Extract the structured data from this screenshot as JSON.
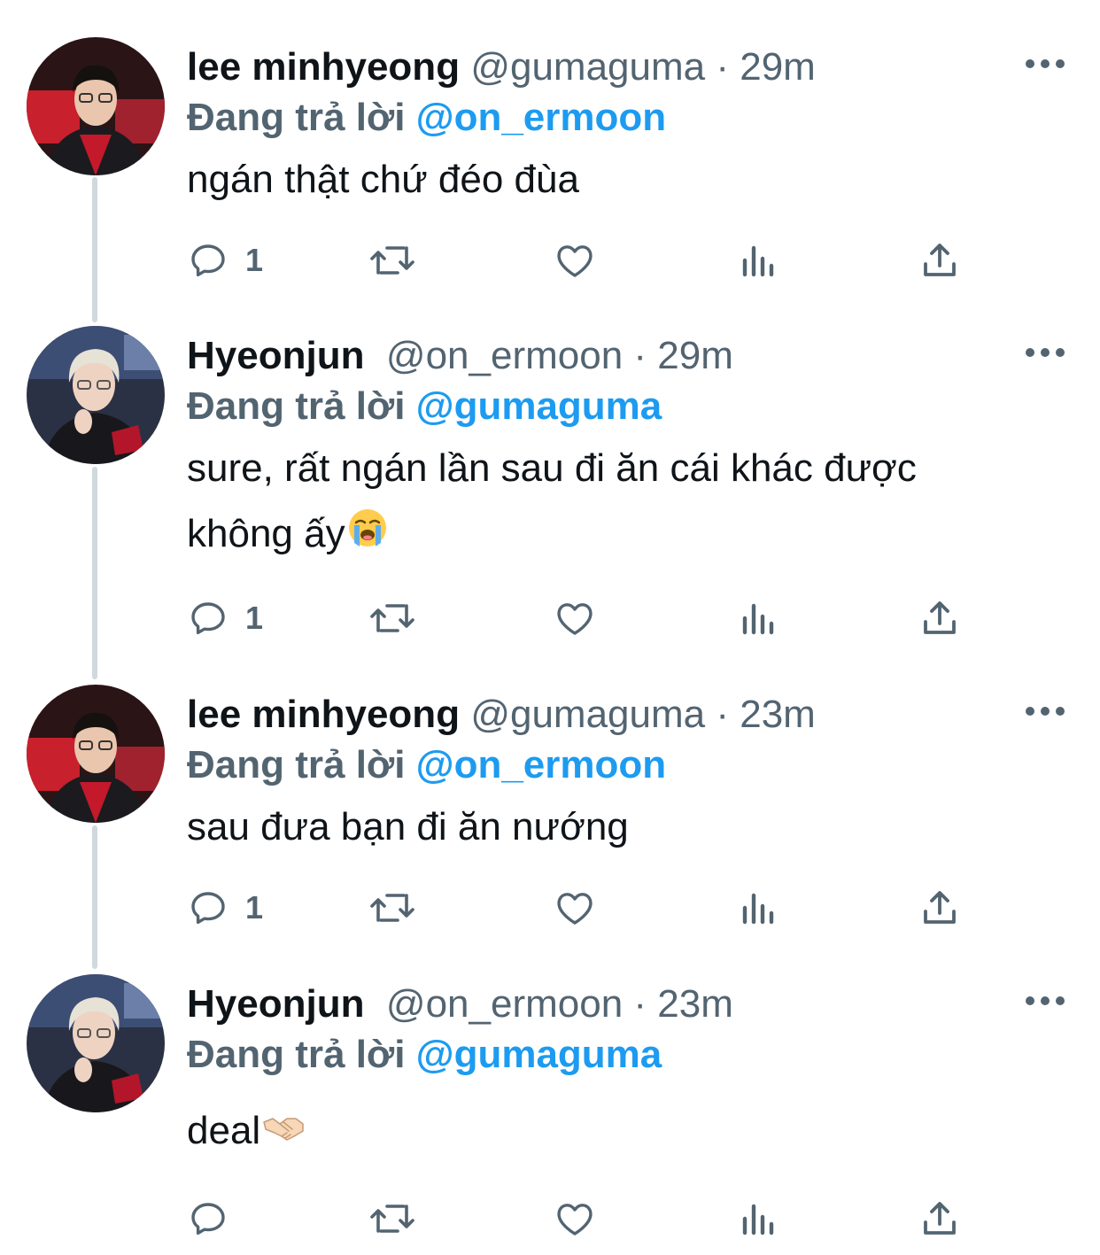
{
  "tweets": [
    {
      "display_name": "lee minhyeong",
      "handle": "@gumaguma",
      "separator": "·",
      "time": "29m",
      "replying_prefix": "Đang trả lời",
      "replying_to": "@on_ermoon",
      "text_lines": [
        "ngán thật chứ đéo đùa"
      ],
      "emoji": "",
      "reply_count": "1",
      "avatar": "user-avatar-lee-minhyeong"
    },
    {
      "display_name": "Hyeonjun",
      "handle": "@on_ermoon",
      "separator": "·",
      "time": "29m",
      "replying_prefix": "Đang trả lời",
      "replying_to": "@gumaguma",
      "text_lines": [
        "sure, rất ngán lần sau đi ăn cái khác được",
        "không ấy"
      ],
      "emoji": "loudly-crying-face-emoji",
      "reply_count": "1",
      "avatar": "user-avatar-hyeonjun"
    },
    {
      "display_name": "lee minhyeong",
      "handle": "@gumaguma",
      "separator": "·",
      "time": "23m",
      "replying_prefix": "Đang trả lời",
      "replying_to": "@on_ermoon",
      "text_lines": [
        "sau đưa bạn đi ăn nướng"
      ],
      "emoji": "",
      "reply_count": "1",
      "avatar": "user-avatar-lee-minhyeong"
    },
    {
      "display_name": "Hyeonjun",
      "handle": "@on_ermoon",
      "separator": "·",
      "time": "23m",
      "replying_prefix": "Đang trả lời",
      "replying_to": "@gumaguma",
      "text_lines": [
        "deal"
      ],
      "emoji": "handshake-emoji",
      "reply_count": "",
      "avatar": "user-avatar-hyeonjun"
    }
  ],
  "icons": {
    "reply": "reply-icon",
    "retweet": "retweet-icon",
    "like": "heart-icon",
    "views": "views-icon",
    "share": "share-icon",
    "more": "more-icon"
  },
  "colors": {
    "text_primary": "#0f1419",
    "text_secondary": "#536471",
    "link": "#1d9bf0",
    "thread_line": "#cfd9de"
  }
}
